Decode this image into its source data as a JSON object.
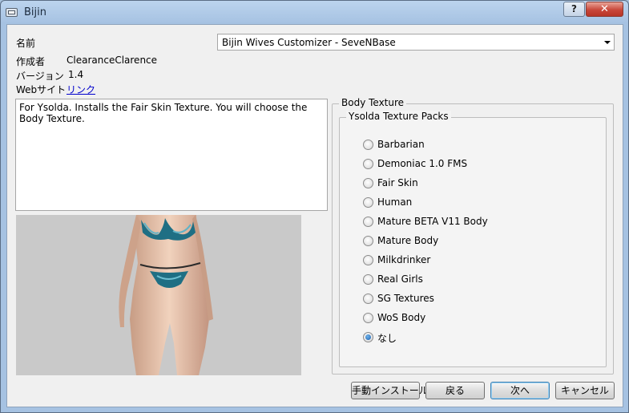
{
  "window": {
    "title": "Bijin",
    "help_label": "?",
    "close_label": "✕"
  },
  "fields": {
    "name_label": "名前",
    "author_label": "作成者",
    "author_value": "ClearanceClarence",
    "version_label": "バージョン",
    "version_value": "1.4",
    "website_label": "Webサイト",
    "website_link": "リンク"
  },
  "combo": {
    "selected": "Bijin Wives Customizer - SeveNBase"
  },
  "description": "For Ysolda. Installs the Fair Skin Texture. You will choose the Body Texture.",
  "body_texture": {
    "title": "Body Texture",
    "group_title": "Ysolda Texture Packs",
    "options": [
      {
        "label": "Barbarian",
        "checked": false
      },
      {
        "label": "Demoniac 1.0 FMS",
        "checked": false
      },
      {
        "label": "Fair Skin",
        "checked": false
      },
      {
        "label": "Human",
        "checked": false
      },
      {
        "label": "Mature BETA V11 Body",
        "checked": false
      },
      {
        "label": "Mature Body",
        "checked": false
      },
      {
        "label": "Milkdrinker",
        "checked": false
      },
      {
        "label": "Real Girls",
        "checked": false
      },
      {
        "label": "SG Textures",
        "checked": false
      },
      {
        "label": "WoS Body",
        "checked": false
      },
      {
        "label": "なし",
        "checked": true
      }
    ]
  },
  "buttons": {
    "manual_install": "手動インストール",
    "back": "戻る",
    "next": "次へ",
    "cancel": "キャンセル"
  },
  "colors": {
    "accent": "#1c5fae",
    "link": "#0000cc",
    "close": "#c8473a"
  }
}
